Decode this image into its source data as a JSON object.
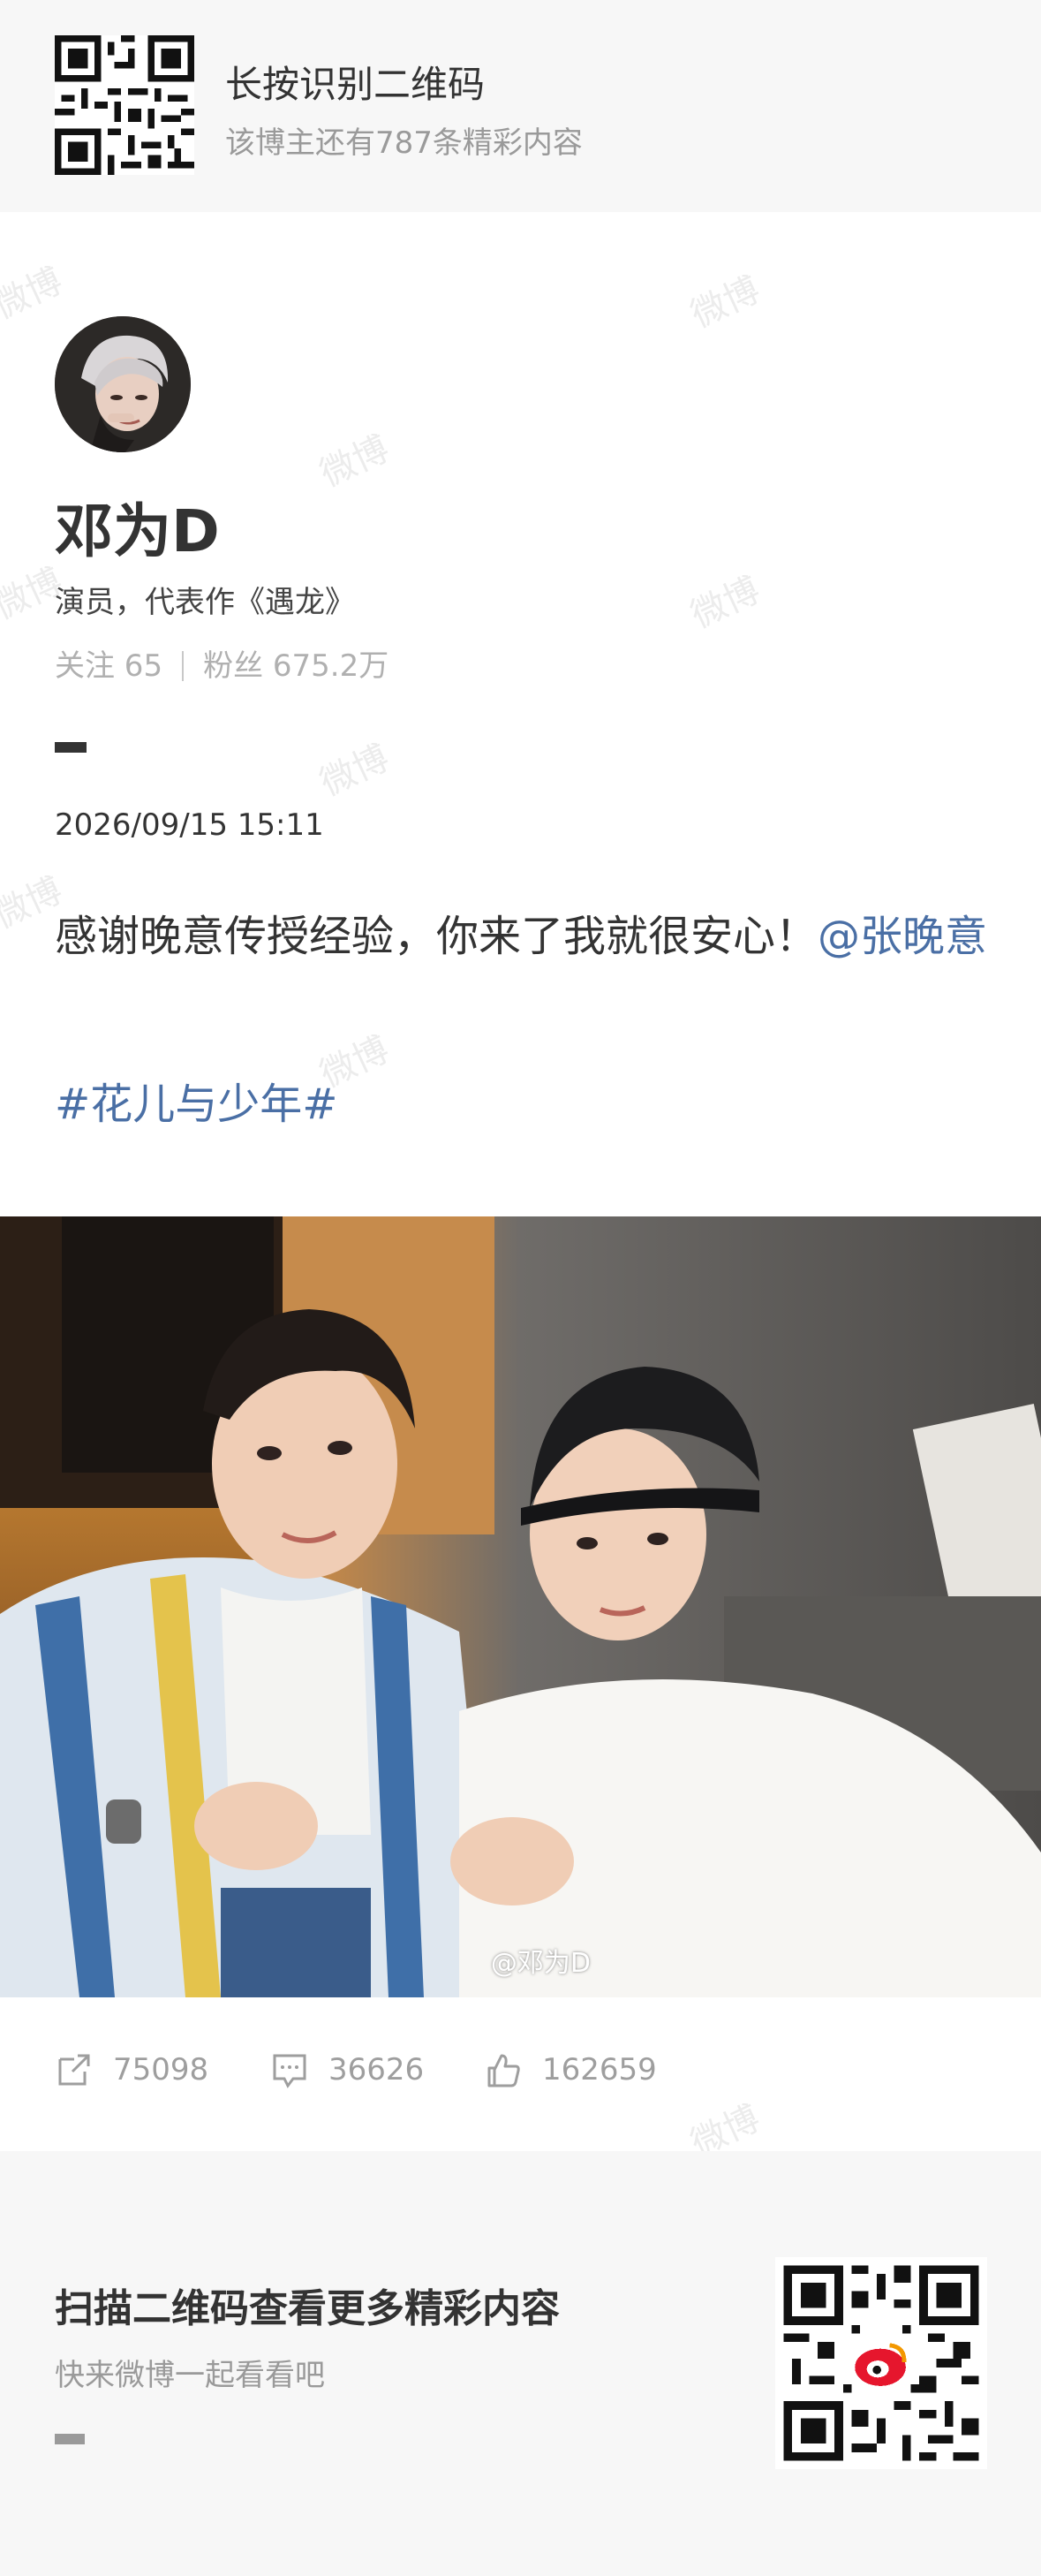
{
  "top_banner": {
    "title": "长按识别二维码",
    "subtitle": "该博主还有787条精彩内容"
  },
  "profile": {
    "name": "邓为D",
    "bio": "演员，代表作《遇龙》",
    "follow_label": "关注 65",
    "fans_label": "粉丝 675.2万"
  },
  "post": {
    "time": "2026/09/15 15:11",
    "text": "感谢晚意传授经验，你来了我就很安心！",
    "mention": "@张晚意",
    "hashtag": "#花儿与少年#",
    "photo_watermark": "@邓为D"
  },
  "actions": {
    "repost_count": "75098",
    "comment_count": "36626",
    "like_count": "162659"
  },
  "bottom_banner": {
    "title": "扫描二维码查看更多精彩内容",
    "subtitle": "快来微博一起看看吧"
  },
  "watermark_text": "微博",
  "colors": {
    "link": "#4a6fa5",
    "banner_bg": "#f7f7f7",
    "muted": "#9a9a9a"
  }
}
